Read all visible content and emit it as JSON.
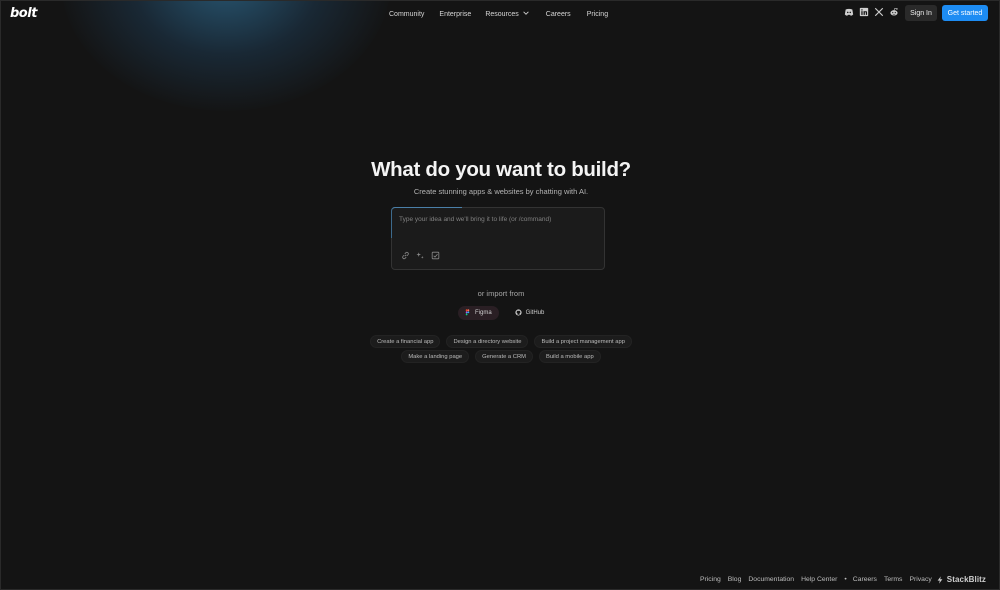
{
  "header": {
    "logo": "bolt",
    "nav": [
      {
        "label": "Community"
      },
      {
        "label": "Enterprise"
      },
      {
        "label": "Resources",
        "icon": "chevron-down-icon"
      },
      {
        "label": "Careers"
      },
      {
        "label": "Pricing"
      }
    ],
    "social_icons": [
      "discord-icon",
      "linkedin-icon",
      "x-icon",
      "reddit-icon"
    ],
    "sign_in_label": "Sign In",
    "get_started_label": "Get started"
  },
  "hero": {
    "title": "What do you want to build?",
    "subtitle": "Create stunning apps & websites by chatting with AI."
  },
  "prompt": {
    "placeholder": "Type your idea and we'll bring it to life (or /command)",
    "value": "",
    "tool_icons": [
      "link-icon",
      "sparkle-icon",
      "select-icon"
    ]
  },
  "import": {
    "label": "or import from",
    "sources": [
      {
        "label": "Figma",
        "icon": "figma-icon"
      },
      {
        "label": "GitHub",
        "icon": "github-icon"
      }
    ]
  },
  "suggestions": {
    "row1": [
      "Create a financial app",
      "Design a directory website",
      "Build a project management app"
    ],
    "row2": [
      "Make a landing page",
      "Generate a CRM",
      "Build a mobile app"
    ]
  },
  "footer": {
    "links": [
      "Pricing",
      "Blog",
      "Documentation",
      "Help Center"
    ],
    "separator": "•",
    "links2": [
      "Careers",
      "Terms",
      "Privacy"
    ],
    "brand": "StackBlitz"
  },
  "colors": {
    "background": "#141414",
    "accent": "#1d8cf3",
    "glow": "#388cbe"
  }
}
